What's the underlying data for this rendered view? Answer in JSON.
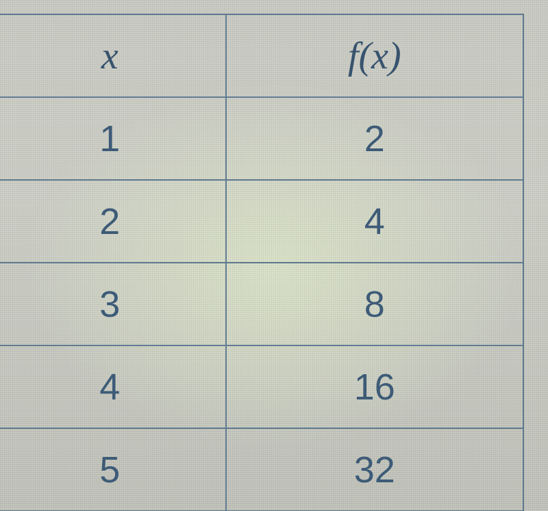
{
  "chart_data": {
    "type": "table",
    "title": "",
    "columns": [
      "x",
      "f(x)"
    ],
    "rows": [
      {
        "x": 1,
        "fx": 2
      },
      {
        "x": 2,
        "fx": 4
      },
      {
        "x": 3,
        "fx": 8
      },
      {
        "x": 4,
        "fx": 16
      },
      {
        "x": 5,
        "fx": 32
      }
    ]
  }
}
